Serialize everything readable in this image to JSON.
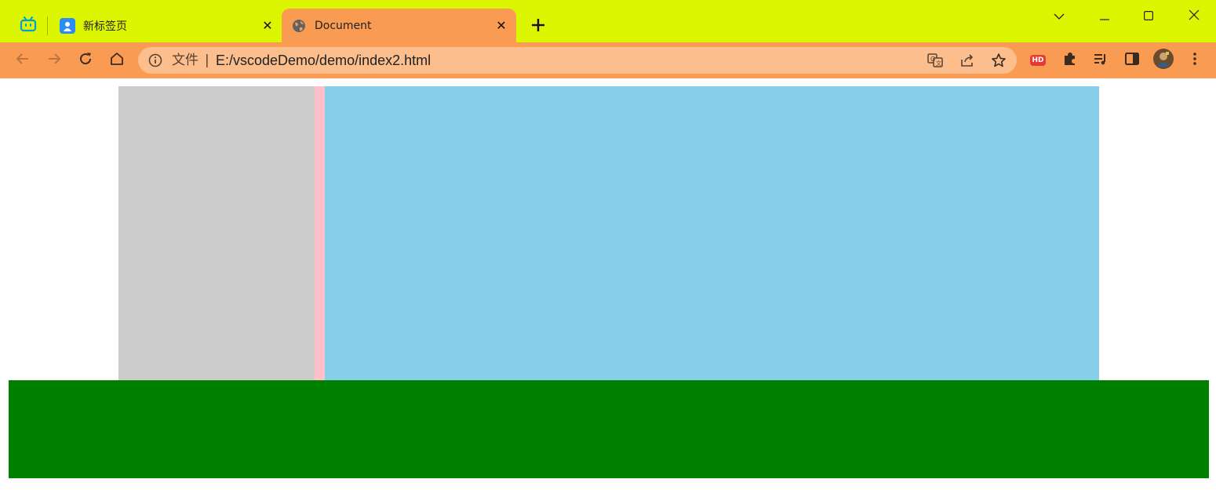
{
  "browser": {
    "tabs": [
      {
        "title": "新标签页",
        "favicon": "new-tab-favicon",
        "active": false
      },
      {
        "title": "Document",
        "favicon": "globe-icon",
        "active": true
      }
    ],
    "pinned_tab_icon": "bilibili-icon",
    "omnibox": {
      "scheme_label": "文件",
      "divider": "|",
      "url": "E:/vscodeDemo/demo/index2.html"
    },
    "extension_badge": "HD",
    "theme": {
      "tabstrip_color": "#dcf500",
      "toolbar_color": "#f99b53",
      "omnibox_color": "#fbbe8c"
    }
  },
  "page": {
    "colors": {
      "left_box": "#cccccc",
      "middle_box": "#ffc0cb",
      "right_box": "#87ceeb",
      "footer": "#008000"
    }
  }
}
